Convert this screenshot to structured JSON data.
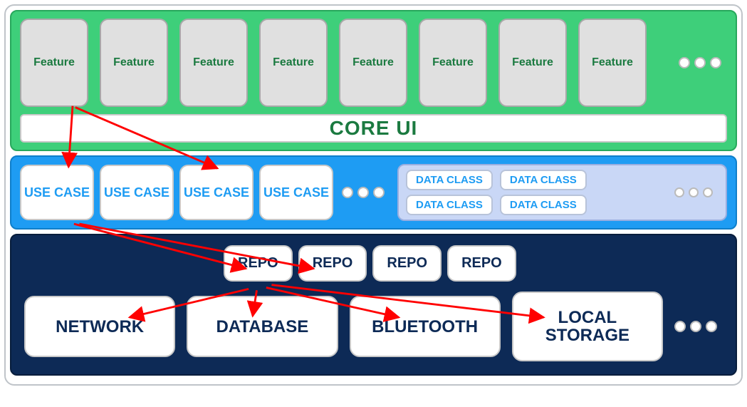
{
  "layers": {
    "features": {
      "items": [
        "Feature",
        "Feature",
        "Feature",
        "Feature",
        "Feature",
        "Feature",
        "Feature",
        "Feature"
      ],
      "core_ui_label": "CORE UI"
    },
    "usecases": {
      "items": [
        "USE CASE",
        "USE CASE",
        "USE CASE",
        "USE CASE"
      ],
      "dataclasses": [
        "DATA CLASS",
        "DATA CLASS",
        "DATA CLASS",
        "DATA CLASS"
      ]
    },
    "data": {
      "repos": [
        "REPO",
        "REPO",
        "REPO",
        "REPO"
      ],
      "sources": [
        "NETWORK",
        "DATABASE",
        "BLUETOOTH",
        "LOCAL STORAGE"
      ]
    }
  },
  "arrows": [
    {
      "from": "feature-1",
      "to": "usecase-1"
    },
    {
      "from": "feature-1",
      "to": "usecase-3"
    },
    {
      "from": "usecase-1",
      "to": "repo-1"
    },
    {
      "from": "usecase-1",
      "to": "repo-2"
    },
    {
      "from": "repo-1",
      "to": "source-network"
    },
    {
      "from": "repo-1",
      "to": "source-database"
    },
    {
      "from": "repo-1",
      "to": "source-bluetooth"
    },
    {
      "from": "repo-1",
      "to": "source-local-storage"
    }
  ],
  "colors": {
    "feature_layer": "#3ecf7a",
    "usecase_layer": "#1e9cf3",
    "data_layer": "#0d2a56",
    "arrow": "#ff0000"
  }
}
